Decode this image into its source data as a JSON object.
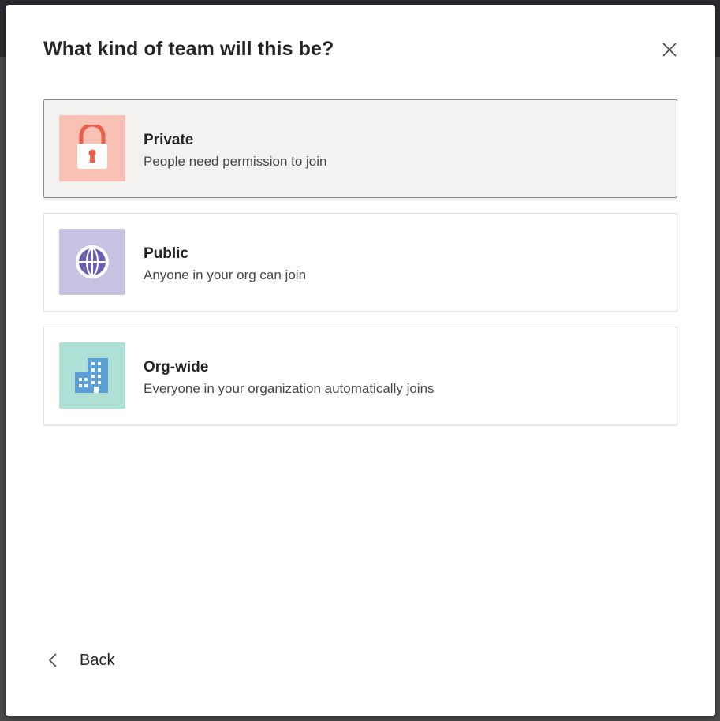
{
  "dialog": {
    "title": "What kind of team will this be?",
    "close_icon": "close-icon"
  },
  "options": [
    {
      "title": "Private",
      "description": "People need permission to join",
      "icon": "lock-icon",
      "tile_color": "#f9c0b4",
      "icon_color": "#e8604c",
      "selected": true
    },
    {
      "title": "Public",
      "description": "Anyone in your org can join",
      "icon": "globe-icon",
      "tile_color": "#c9c3e3",
      "icon_color": "#6b5fb0",
      "selected": false
    },
    {
      "title": "Org-wide",
      "description": "Everyone in your organization automatically joins",
      "icon": "building-icon",
      "tile_color": "#aee0d5",
      "icon_color": "#5aa0d6",
      "selected": false
    }
  ],
  "footer": {
    "back_label": "Back",
    "back_icon": "chevron-left-icon"
  }
}
